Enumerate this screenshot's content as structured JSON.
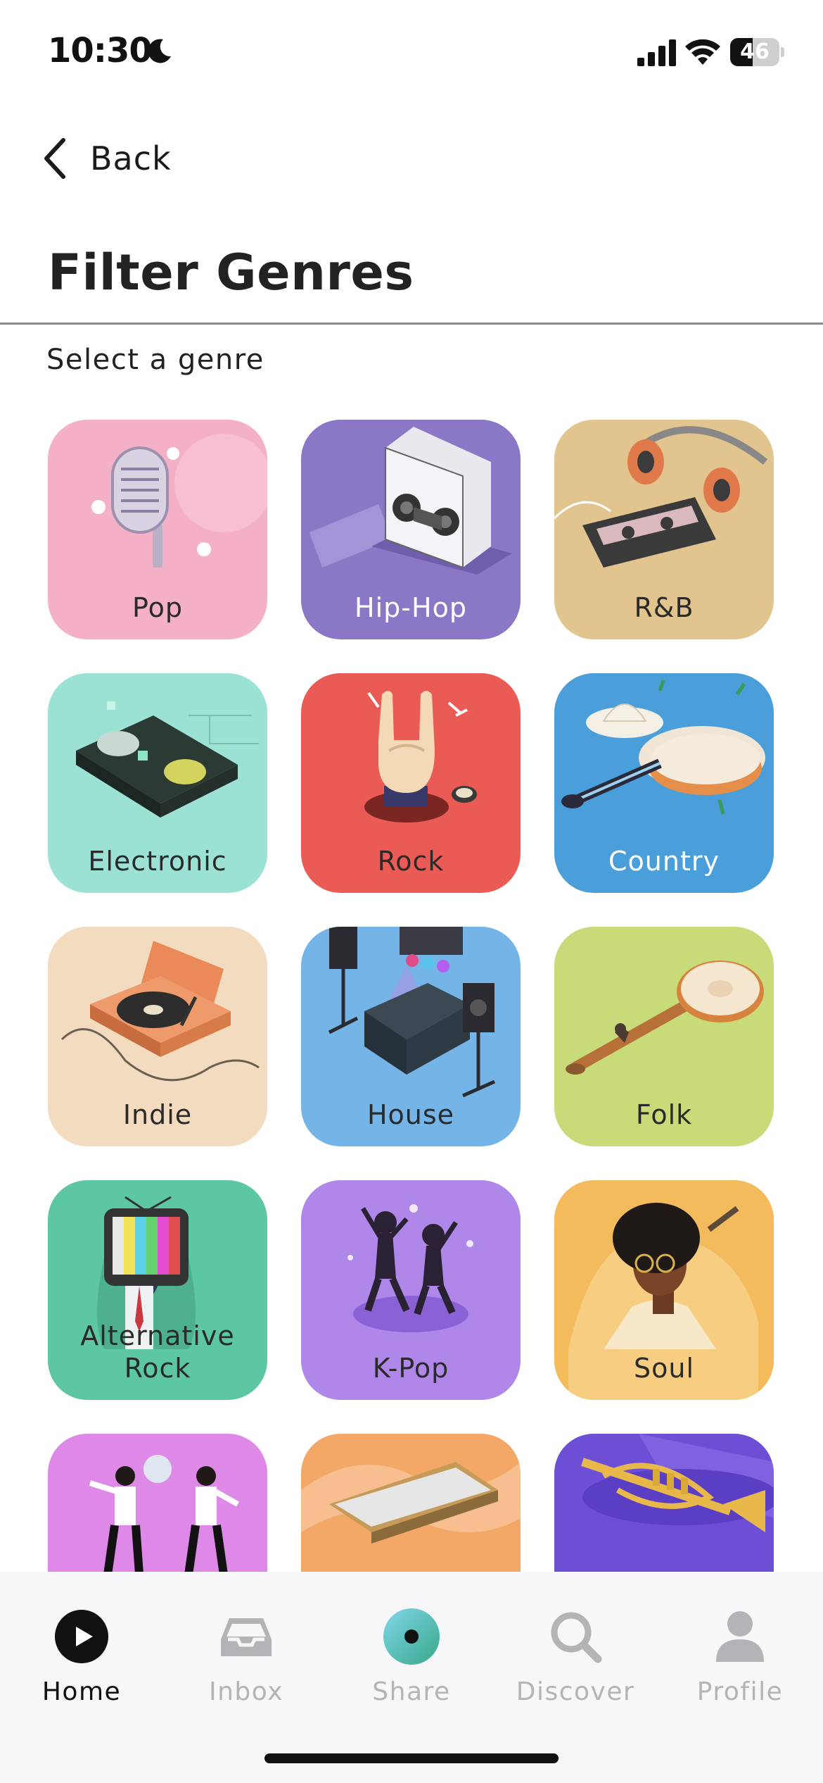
{
  "status_bar": {
    "time": "10:30",
    "battery_percent": 46,
    "battery_label": "46"
  },
  "nav": {
    "back_label": "Back"
  },
  "page": {
    "title": "Filter Genres",
    "subtitle": "Select a genre"
  },
  "genres": [
    {
      "label": "Pop",
      "color": "#F3B0C7",
      "icon": "microphone-icon"
    },
    {
      "label": "Hip-Hop",
      "color": "#8A78C7",
      "icon": "boombox-icon"
    },
    {
      "label": "R&B",
      "color": "#E2C58E",
      "icon": "cassette-headphones-icon"
    },
    {
      "label": "Electronic",
      "color": "#9BE2D5",
      "icon": "dj-mixer-icon"
    },
    {
      "label": "Rock",
      "color": "#EB5B56",
      "icon": "rock-hand-icon"
    },
    {
      "label": "Country",
      "color": "#4A9FDB",
      "icon": "guitar-hat-icon"
    },
    {
      "label": "Indie",
      "color": "#F2DBBF",
      "icon": "record-player-icon"
    },
    {
      "label": "House",
      "color": "#74B4E6",
      "icon": "stage-speakers-icon"
    },
    {
      "label": "Folk",
      "color": "#C8DB78",
      "icon": "banjo-icon"
    },
    {
      "label": "Alternative Rock",
      "color": "#5DC7A4",
      "icon": "tv-head-icon"
    },
    {
      "label": "K-Pop",
      "color": "#AE87E8",
      "icon": "dancers-icon"
    },
    {
      "label": "Soul",
      "color": "#F4BB5C",
      "icon": "afro-singer-icon"
    },
    {
      "label": "",
      "color": "#DE89E8",
      "icon": "disco-dancers-icon"
    },
    {
      "label": "",
      "color": "#F3A868",
      "icon": "harmonica-icon"
    },
    {
      "label": "",
      "color": "#6D4FD6",
      "icon": "trumpet-icon"
    }
  ],
  "tabs": [
    {
      "label": "Home",
      "icon": "home-play-icon",
      "active": true
    },
    {
      "label": "Inbox",
      "icon": "inbox-icon",
      "active": false
    },
    {
      "label": "Share",
      "icon": "share-orb-icon",
      "active": false
    },
    {
      "label": "Discover",
      "icon": "search-icon",
      "active": false
    },
    {
      "label": "Profile",
      "icon": "profile-icon",
      "active": false
    }
  ]
}
